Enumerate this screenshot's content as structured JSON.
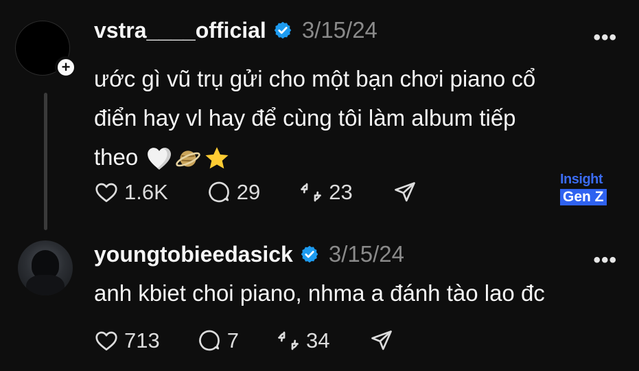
{
  "posts": [
    {
      "username": "vstra____official",
      "date": "3/15/24",
      "text": "ước gì vũ trụ gửi cho một bạn chơi piano cổ\nđiển hay vl hay để cùng tôi làm album tiếp\ntheo",
      "emojis": [
        "white-heart",
        "ringed-planet",
        "star"
      ],
      "likes": "1.6K",
      "replies": "29",
      "reposts": "23",
      "more_label": "•••",
      "follow_badge": "+"
    },
    {
      "username": "youngtobieedasick",
      "date": "3/15/24",
      "text": "anh kbiet choi piano, nhma a đánh tào lao đc",
      "likes": "713",
      "replies": "7",
      "reposts": "34",
      "more_label": "•••"
    }
  ],
  "watermark": {
    "top": "Insight",
    "bottom": "Gen Z"
  },
  "colors": {
    "background": "#0e0e0e",
    "verified": "#1d9bf0",
    "watermark_blue": "#2f62f0"
  }
}
